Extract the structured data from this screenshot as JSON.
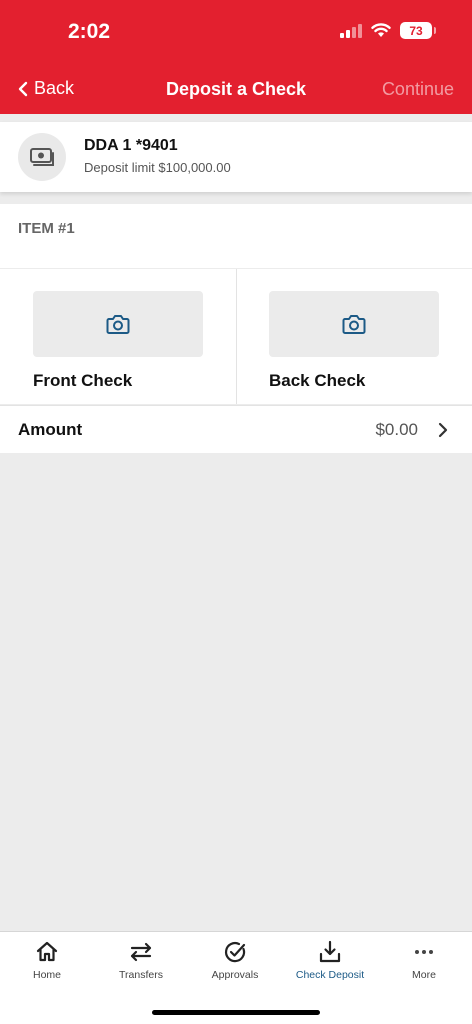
{
  "status_bar": {
    "time": "2:02",
    "battery": "73",
    "icons": [
      "signal-icon",
      "wifi-icon",
      "battery-icon"
    ]
  },
  "nav": {
    "back_label": "Back",
    "title": "Deposit a Check",
    "continue_label": "Continue"
  },
  "account": {
    "name": "DDA 1 *9401",
    "limit": "Deposit limit $100,000.00",
    "icon": "cash-icon"
  },
  "item": {
    "label": "ITEM #1",
    "front_label": "Front Check",
    "back_label": "Back Check",
    "camera_icon": "camera-icon"
  },
  "amount": {
    "label": "Amount",
    "value": "$0.00"
  },
  "tabs": [
    {
      "label": "Home",
      "icon": "home-icon",
      "active": false
    },
    {
      "label": "Transfers",
      "icon": "transfer-arrows-icon",
      "active": false
    },
    {
      "label": "Approvals",
      "icon": "check-circle-icon",
      "active": false
    },
    {
      "label": "Check Deposit",
      "icon": "download-tray-icon",
      "active": true
    },
    {
      "label": "More",
      "icon": "more-dots-icon",
      "active": false
    }
  ],
  "colors": {
    "brand_red": "#e3202f",
    "accent_blue": "#1c5a86",
    "background_gray": "#ececec"
  }
}
